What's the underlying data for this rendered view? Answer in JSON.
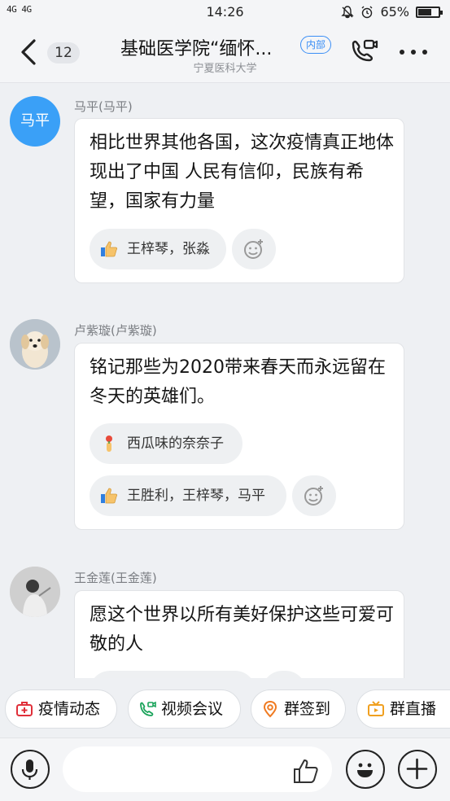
{
  "status_bar": {
    "signal_text": "4G 4G",
    "time": "14:26",
    "battery": "65%",
    "battery_level": 0.65
  },
  "header": {
    "unread_count": "12",
    "title": "基础医学院“缅怀...",
    "tag": "内部",
    "subtitle": "宁夏医科大学"
  },
  "messages": [
    {
      "sender": "马平(马平)",
      "avatar_text": "马平",
      "text": "相比世界其他各国，这次疫情真正地体现出了中国 人民有信仰，民族有希望，国家有力量",
      "reactions": [
        {
          "icon": "thumbs-up-icon",
          "users": "王梓琴，张淼"
        }
      ]
    },
    {
      "sender": "卢紫璇(卢紫璇)",
      "avatar_text": "",
      "text": "铭记那些为2020带来春天而永远留在冬天的英雄们。",
      "reactions": [
        {
          "icon": "flower-icon",
          "users": "西瓜味的奈奈子"
        },
        {
          "icon": "thumbs-up-icon",
          "users": "王胜利，王梓琴，马平"
        }
      ]
    },
    {
      "sender": "王金莲(王金莲)",
      "avatar_text": "",
      "text": "愿这个世界以所有美好保护这些可爱可敬的人",
      "reactions": []
    }
  ],
  "quick_actions": [
    {
      "label": "疫情动态",
      "icon": "medical-kit-icon",
      "color": "#e0303a"
    },
    {
      "label": "视频会议",
      "icon": "video-call-icon",
      "color": "#1aa35a"
    },
    {
      "label": "群签到",
      "icon": "location-pin-icon",
      "color": "#f07b22"
    },
    {
      "label": "群直播",
      "icon": "tv-icon",
      "color": "#f0a020"
    }
  ],
  "colors": {
    "accent": "#3a8ef6",
    "avatar_blue": "#3aa0f7",
    "background": "#eef0f3"
  }
}
